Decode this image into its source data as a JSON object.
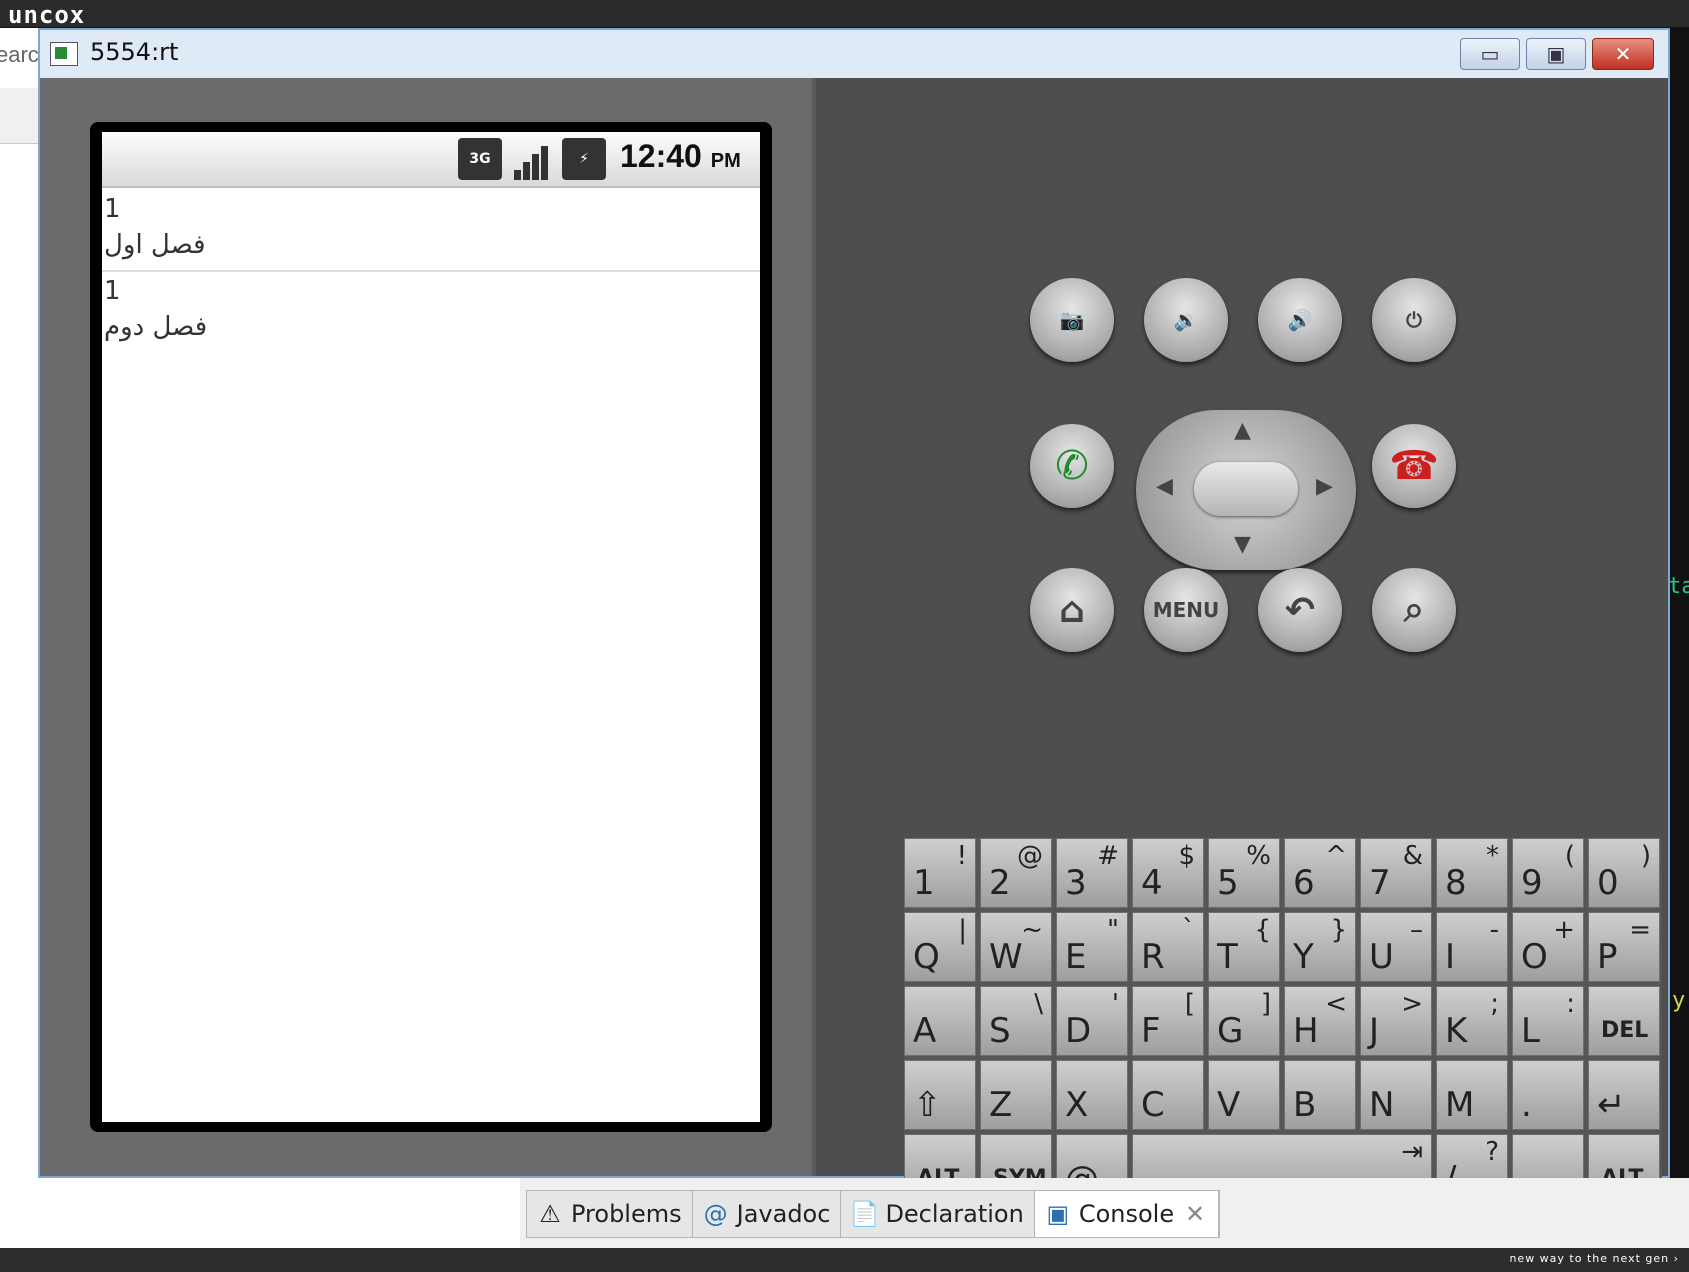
{
  "brand": {
    "logo": "uncox",
    "slogan": "new way to the next gen ›"
  },
  "ide": {
    "search_fragment": "earc",
    "right_code_1": "ta",
    "right_code_2": "y"
  },
  "window": {
    "title": "5554:rt",
    "min_label": "▭",
    "max_label": "▣",
    "close_label": "✕"
  },
  "phone": {
    "status": {
      "network": "3G",
      "time": "12:40",
      "ampm": "PM"
    },
    "list": [
      {
        "number": "1",
        "text": "فصل اول"
      },
      {
        "number": "1",
        "text": "فصل دوم"
      }
    ]
  },
  "hw_buttons": {
    "menu_label": "MENU"
  },
  "keyboard": {
    "rows": [
      [
        {
          "m": "1",
          "s": "!"
        },
        {
          "m": "2",
          "s": "@"
        },
        {
          "m": "3",
          "s": "#"
        },
        {
          "m": "4",
          "s": "$"
        },
        {
          "m": "5",
          "s": "%"
        },
        {
          "m": "6",
          "s": "^"
        },
        {
          "m": "7",
          "s": "&"
        },
        {
          "m": "8",
          "s": "*"
        },
        {
          "m": "9",
          "s": "("
        },
        {
          "m": "0",
          "s": ")"
        }
      ],
      [
        {
          "m": "Q",
          "s": "|"
        },
        {
          "m": "W",
          "s": "~"
        },
        {
          "m": "E",
          "s": "\""
        },
        {
          "m": "R",
          "s": "`"
        },
        {
          "m": "T",
          "s": "{"
        },
        {
          "m": "Y",
          "s": "}"
        },
        {
          "m": "U",
          "s": "–"
        },
        {
          "m": "I",
          "s": "-"
        },
        {
          "m": "O",
          "s": "+"
        },
        {
          "m": "P",
          "s": "="
        }
      ],
      [
        {
          "m": "A",
          "s": ""
        },
        {
          "m": "S",
          "s": "\\"
        },
        {
          "m": "D",
          "s": "'"
        },
        {
          "m": "F",
          "s": "["
        },
        {
          "m": "G",
          "s": "]"
        },
        {
          "m": "H",
          "s": "<"
        },
        {
          "m": "J",
          "s": ">"
        },
        {
          "m": "K",
          "s": ";"
        },
        {
          "m": "L",
          "s": ":"
        },
        {
          "m": "DEL",
          "s": ""
        }
      ],
      [
        {
          "m": "⇧",
          "s": ""
        },
        {
          "m": "Z",
          "s": ""
        },
        {
          "m": "X",
          "s": ""
        },
        {
          "m": "C",
          "s": ""
        },
        {
          "m": "V",
          "s": ""
        },
        {
          "m": "B",
          "s": ""
        },
        {
          "m": "N",
          "s": ""
        },
        {
          "m": "M",
          "s": ""
        },
        {
          "m": ".",
          "s": ""
        },
        {
          "m": "↵",
          "s": ""
        }
      ]
    ],
    "bottom": {
      "alt": "ALT",
      "sym": "SYM",
      "at": "@",
      "space": "␣",
      "tab": "⇥",
      "slash": "/",
      "question": "?",
      "comma": ",",
      "alt2": "ALT"
    }
  },
  "tabs": [
    {
      "label": "Problems",
      "icon": "problems-icon"
    },
    {
      "label": "Javadoc",
      "icon": "at-icon"
    },
    {
      "label": "Declaration",
      "icon": "declaration-icon"
    },
    {
      "label": "Console",
      "icon": "console-icon",
      "active": true
    }
  ],
  "colors": {
    "call_green": "#1f8a2b",
    "end_red": "#cc1f1f",
    "window_border": "#7ea7d0"
  }
}
